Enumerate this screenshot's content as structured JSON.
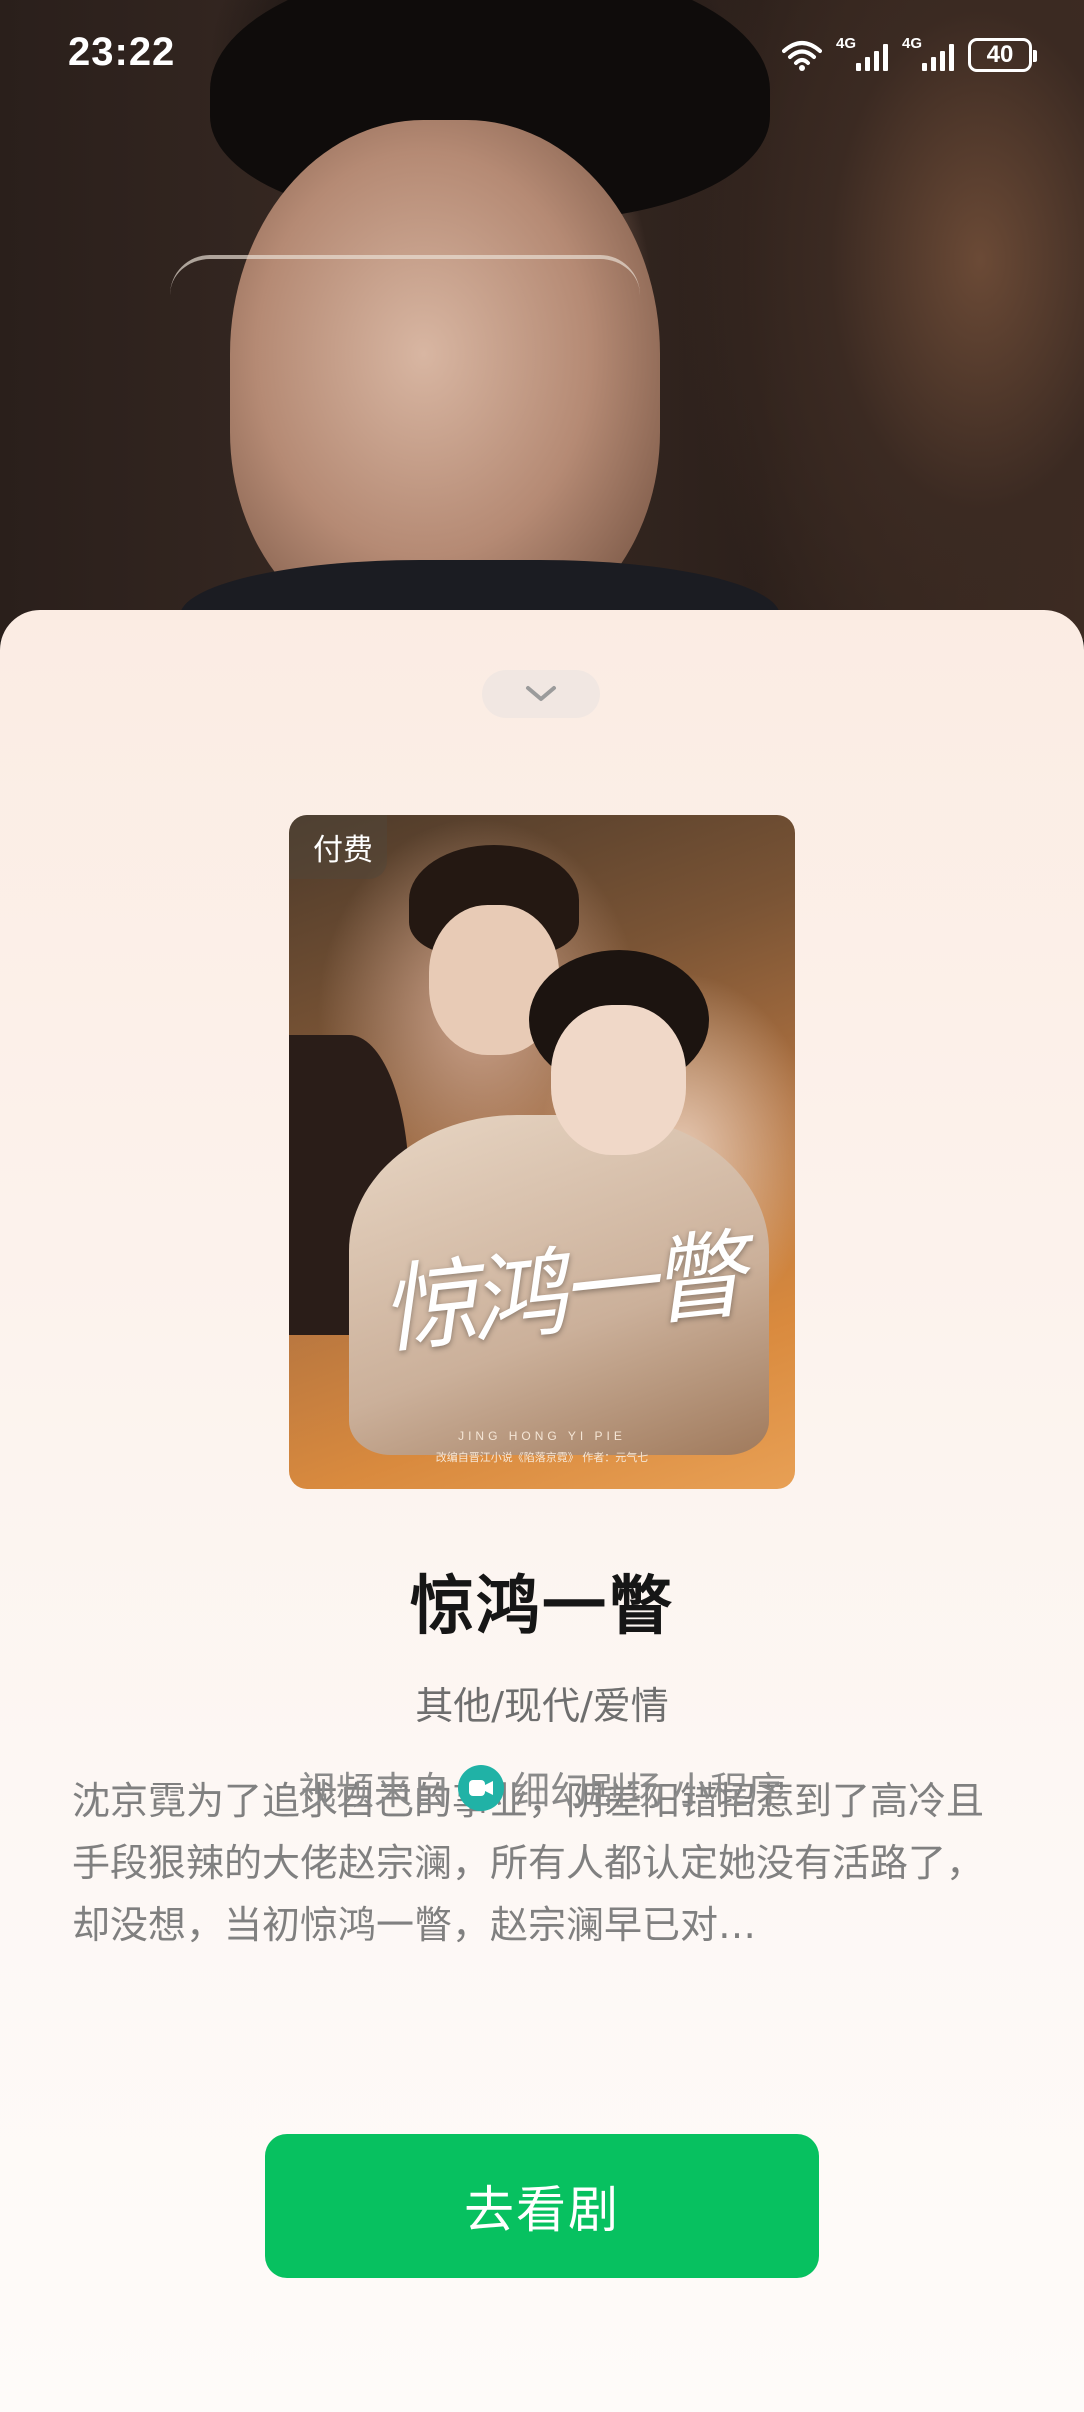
{
  "status_bar": {
    "time": "23:22",
    "network_1": "4G",
    "network_2": "4G",
    "battery": "40"
  },
  "sheet": {
    "poster": {
      "badge": "付费",
      "calligraphy": "惊鸿一瞥",
      "pinyin": "JING HONG YI PIE",
      "credit": "改编自晋江小说《陷落京霓》  作者：元气七"
    },
    "title": "惊鸿一瞥",
    "genre": "其他/现代/爱情",
    "description": "沈京霓为了追求自己的事业，阴差阳错招惹到了高冷且手段狠辣的大佬赵宗澜，所有人都认定她没有活路了，却没想，当初惊鸿一瞥，赵宗澜早已对…",
    "watch_button": "去看剧",
    "source": {
      "prefix": "视频来自",
      "name": "细幻剧场",
      "suffix": "小程序"
    }
  },
  "colors": {
    "accent_green": "#07c160",
    "mini_program_icon": "#20b2a6"
  }
}
